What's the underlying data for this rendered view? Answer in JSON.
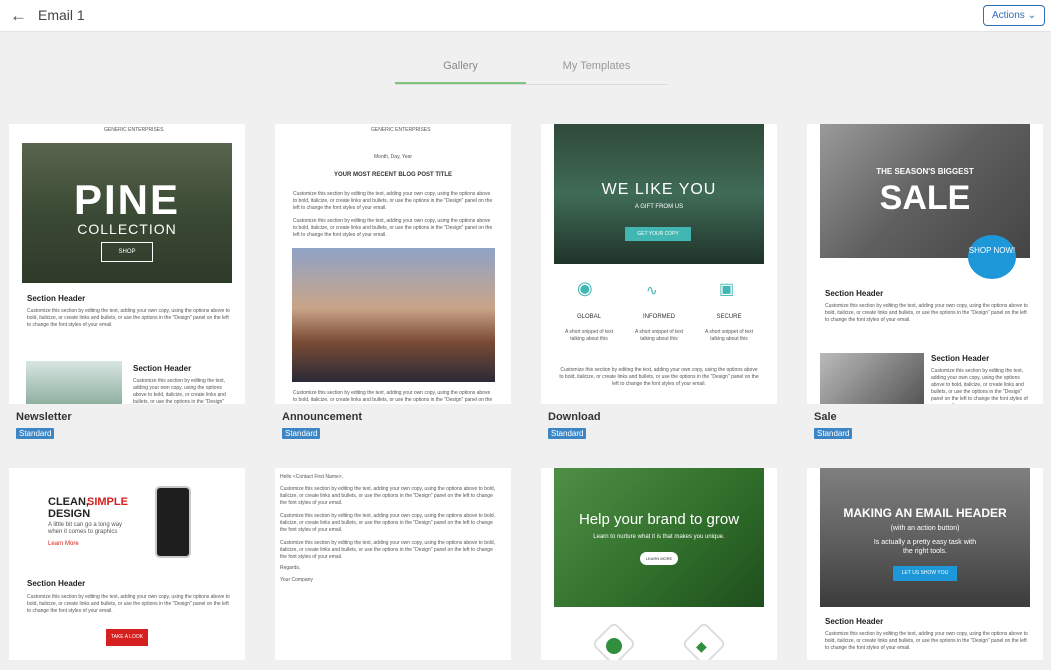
{
  "header": {
    "title": "Email 1",
    "actions_label": "Actions ⌄"
  },
  "tabs": [
    {
      "label": "Gallery"
    },
    {
      "label": "My Templates"
    }
  ],
  "templates": [
    {
      "name": "Newsletter",
      "badge": "Standard",
      "brand": "GENERIC ENTERPRISES",
      "hero1": "PINE",
      "hero2": "COLLECTION",
      "cta": "SHOP",
      "section1": "Section Header",
      "section2": "Section Header"
    },
    {
      "name": "Announcement",
      "badge": "Standard",
      "brand": "GENERIC ENTERPRISES",
      "date": "Month, Day, Year",
      "post_title": "YOUR MOST RECENT BLOG POST TITLE"
    },
    {
      "name": "Download",
      "badge": "Standard",
      "hero": "WE LIKE YOU",
      "sub": "A GIFT FROM US",
      "cta": "GET YOUR COPY",
      "features": [
        "GLOBAL",
        "INFORMED",
        "SECURE"
      ],
      "feature_text": "A short snippet of text talking about this"
    },
    {
      "name": "Sale",
      "badge": "Standard",
      "kicker": "THE SEASON'S BIGGEST",
      "hero": "SALE",
      "cta": "SHOP NOW!",
      "section1": "Section Header",
      "section2": "Section Header"
    },
    {
      "clean": "CLEAN,",
      "simple": "SIMPLE",
      "design": "DESIGN",
      "tagline": "A little bit can go a long way when it comes to graphics",
      "learn": "Learn More",
      "section": "Section Header",
      "cta": "TAKE A LOOK"
    },
    {
      "greeting": "Hello <Contact First Name>,",
      "regards": "Regards,",
      "company": "Your Company"
    },
    {
      "hero": "Help your brand to grow",
      "sub": "Learn to nurture what it is that makes you unique.",
      "cta": "LEARN MORE"
    },
    {
      "hero": "MAKING AN EMAIL HEADER",
      "sub": "(with an action button)",
      "line": "Is actually a pretty easy task with the right tools.",
      "cta": "LET US SHOW YOU",
      "section": "Section Header"
    }
  ],
  "body_copy": "Customize this section by editing the text, adding your own copy, using the options above to bold, italicize, or create links and bullets, or use the options in the \"Design\" panel on the left to change the font styles of your email."
}
